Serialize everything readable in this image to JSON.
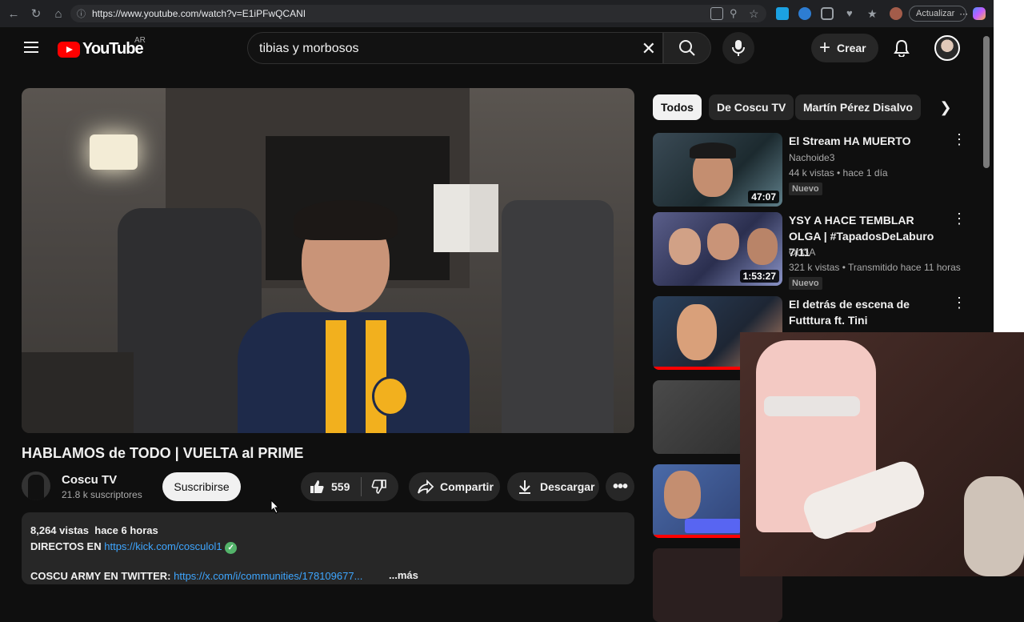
{
  "browser": {
    "url": "https://www.youtube.com/watch?v=E1iPFwQCANI",
    "update_label": "Actualizar"
  },
  "header": {
    "logo_text": "YouTube",
    "country_code": "AR",
    "search_value": "tibias y morbosos",
    "create_label": "Crear"
  },
  "video": {
    "title": "HABLAMOS de TODO | VUELTA al PRIME",
    "channel_name": "Coscu TV",
    "subscribers": "21.8 k suscriptores",
    "subscribe_label": "Suscribirse",
    "likes": "559",
    "share_label": "Compartir",
    "download_label": "Descargar"
  },
  "description": {
    "views": "8,264 vistas",
    "time": "hace 6 horas",
    "line2_prefix": "DIRECTOS EN",
    "line2_link": "https://kick.com/cosculol1",
    "line3_prefix": "COSCU ARMY EN TWITTER:",
    "line3_link": "https://x.com/i/communities/178109677...",
    "more_label": "...más"
  },
  "chips": [
    "Todos",
    "De Coscu TV",
    "Martín Pérez Disalvo"
  ],
  "recommendations": [
    {
      "title": "El Stream HA MUERTO",
      "channel": "Nachoide3",
      "meta": "44 k vistas • hace 1 día",
      "badge": "Nuevo",
      "duration": "47:07"
    },
    {
      "title": "YSY A HACE TEMBLAR OLGA | #TapadosDeLaburo 7/11",
      "channel": "OLGA",
      "meta": "321 k vistas • Transmitido hace 11 horas",
      "badge": "Nuevo",
      "duration": "1:53:27"
    },
    {
      "title": "El detrás de escena de Futttura ft. Tini",
      "channel": "",
      "meta": "",
      "badge": "",
      "duration": ""
    }
  ],
  "colors": {
    "background": "#0f0f0f",
    "accent_red": "#ff0000",
    "link_blue": "#3ea6ff"
  }
}
